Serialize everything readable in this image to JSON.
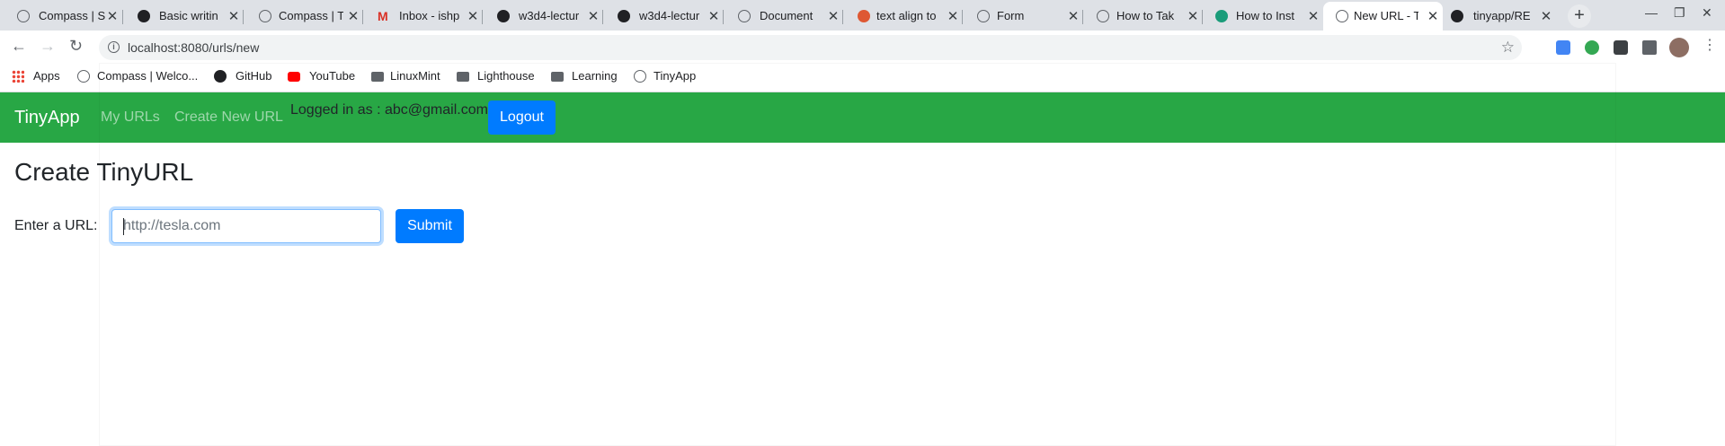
{
  "browser": {
    "tabs": [
      {
        "title": "Compass | S",
        "active": false
      },
      {
        "title": "Basic writin",
        "active": false
      },
      {
        "title": "Compass | T",
        "active": false
      },
      {
        "title": "Inbox - ishp",
        "active": false
      },
      {
        "title": "w3d4-lectur",
        "active": false
      },
      {
        "title": "w3d4-lectur",
        "active": false
      },
      {
        "title": "Document",
        "active": false
      },
      {
        "title": "text align to",
        "active": false
      },
      {
        "title": "Form",
        "active": false
      },
      {
        "title": "How to Tak",
        "active": false
      },
      {
        "title": "How to Inst",
        "active": false
      },
      {
        "title": "New URL - T",
        "active": true
      },
      {
        "title": "tinyapp/RE",
        "active": false
      }
    ],
    "url": "localhost:8080/urls/new",
    "bookmarks": [
      "Apps",
      "Compass | Welco...",
      "GitHub",
      "YouTube",
      "LinuxMint",
      "Lighthouse",
      "Learning",
      "TinyApp"
    ]
  },
  "page": {
    "brand": "TinyApp",
    "nav": {
      "my_urls": "My URLs",
      "create_new": "Create New URL"
    },
    "logged_in": "Logged in as : abc@gmail.com",
    "logout": "Logout",
    "heading": "Create TinyURL",
    "form": {
      "label": "Enter a URL:",
      "placeholder": "http://tesla.com",
      "submit": "Submit"
    }
  },
  "colors": {
    "navbar": "#28a745",
    "primary": "#007bff"
  }
}
